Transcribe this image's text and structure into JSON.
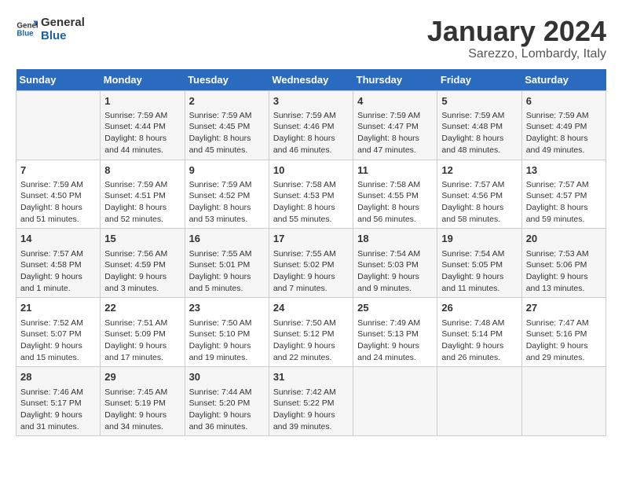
{
  "header": {
    "logo_line1": "General",
    "logo_line2": "Blue",
    "month_title": "January 2024",
    "location": "Sarezzo, Lombardy, Italy"
  },
  "columns": [
    "Sunday",
    "Monday",
    "Tuesday",
    "Wednesday",
    "Thursday",
    "Friday",
    "Saturday"
  ],
  "weeks": [
    [
      {
        "day": "",
        "info": ""
      },
      {
        "day": "1",
        "info": "Sunrise: 7:59 AM\nSunset: 4:44 PM\nDaylight: 8 hours\nand 44 minutes."
      },
      {
        "day": "2",
        "info": "Sunrise: 7:59 AM\nSunset: 4:45 PM\nDaylight: 8 hours\nand 45 minutes."
      },
      {
        "day": "3",
        "info": "Sunrise: 7:59 AM\nSunset: 4:46 PM\nDaylight: 8 hours\nand 46 minutes."
      },
      {
        "day": "4",
        "info": "Sunrise: 7:59 AM\nSunset: 4:47 PM\nDaylight: 8 hours\nand 47 minutes."
      },
      {
        "day": "5",
        "info": "Sunrise: 7:59 AM\nSunset: 4:48 PM\nDaylight: 8 hours\nand 48 minutes."
      },
      {
        "day": "6",
        "info": "Sunrise: 7:59 AM\nSunset: 4:49 PM\nDaylight: 8 hours\nand 49 minutes."
      }
    ],
    [
      {
        "day": "7",
        "info": "Sunrise: 7:59 AM\nSunset: 4:50 PM\nDaylight: 8 hours\nand 51 minutes."
      },
      {
        "day": "8",
        "info": "Sunrise: 7:59 AM\nSunset: 4:51 PM\nDaylight: 8 hours\nand 52 minutes."
      },
      {
        "day": "9",
        "info": "Sunrise: 7:59 AM\nSunset: 4:52 PM\nDaylight: 8 hours\nand 53 minutes."
      },
      {
        "day": "10",
        "info": "Sunrise: 7:58 AM\nSunset: 4:53 PM\nDaylight: 8 hours\nand 55 minutes."
      },
      {
        "day": "11",
        "info": "Sunrise: 7:58 AM\nSunset: 4:55 PM\nDaylight: 8 hours\nand 56 minutes."
      },
      {
        "day": "12",
        "info": "Sunrise: 7:57 AM\nSunset: 4:56 PM\nDaylight: 8 hours\nand 58 minutes."
      },
      {
        "day": "13",
        "info": "Sunrise: 7:57 AM\nSunset: 4:57 PM\nDaylight: 8 hours\nand 59 minutes."
      }
    ],
    [
      {
        "day": "14",
        "info": "Sunrise: 7:57 AM\nSunset: 4:58 PM\nDaylight: 9 hours\nand 1 minute."
      },
      {
        "day": "15",
        "info": "Sunrise: 7:56 AM\nSunset: 4:59 PM\nDaylight: 9 hours\nand 3 minutes."
      },
      {
        "day": "16",
        "info": "Sunrise: 7:55 AM\nSunset: 5:01 PM\nDaylight: 9 hours\nand 5 minutes."
      },
      {
        "day": "17",
        "info": "Sunrise: 7:55 AM\nSunset: 5:02 PM\nDaylight: 9 hours\nand 7 minutes."
      },
      {
        "day": "18",
        "info": "Sunrise: 7:54 AM\nSunset: 5:03 PM\nDaylight: 9 hours\nand 9 minutes."
      },
      {
        "day": "19",
        "info": "Sunrise: 7:54 AM\nSunset: 5:05 PM\nDaylight: 9 hours\nand 11 minutes."
      },
      {
        "day": "20",
        "info": "Sunrise: 7:53 AM\nSunset: 5:06 PM\nDaylight: 9 hours\nand 13 minutes."
      }
    ],
    [
      {
        "day": "21",
        "info": "Sunrise: 7:52 AM\nSunset: 5:07 PM\nDaylight: 9 hours\nand 15 minutes."
      },
      {
        "day": "22",
        "info": "Sunrise: 7:51 AM\nSunset: 5:09 PM\nDaylight: 9 hours\nand 17 minutes."
      },
      {
        "day": "23",
        "info": "Sunrise: 7:50 AM\nSunset: 5:10 PM\nDaylight: 9 hours\nand 19 minutes."
      },
      {
        "day": "24",
        "info": "Sunrise: 7:50 AM\nSunset: 5:12 PM\nDaylight: 9 hours\nand 22 minutes."
      },
      {
        "day": "25",
        "info": "Sunrise: 7:49 AM\nSunset: 5:13 PM\nDaylight: 9 hours\nand 24 minutes."
      },
      {
        "day": "26",
        "info": "Sunrise: 7:48 AM\nSunset: 5:14 PM\nDaylight: 9 hours\nand 26 minutes."
      },
      {
        "day": "27",
        "info": "Sunrise: 7:47 AM\nSunset: 5:16 PM\nDaylight: 9 hours\nand 29 minutes."
      }
    ],
    [
      {
        "day": "28",
        "info": "Sunrise: 7:46 AM\nSunset: 5:17 PM\nDaylight: 9 hours\nand 31 minutes."
      },
      {
        "day": "29",
        "info": "Sunrise: 7:45 AM\nSunset: 5:19 PM\nDaylight: 9 hours\nand 34 minutes."
      },
      {
        "day": "30",
        "info": "Sunrise: 7:44 AM\nSunset: 5:20 PM\nDaylight: 9 hours\nand 36 minutes."
      },
      {
        "day": "31",
        "info": "Sunrise: 7:42 AM\nSunset: 5:22 PM\nDaylight: 9 hours\nand 39 minutes."
      },
      {
        "day": "",
        "info": ""
      },
      {
        "day": "",
        "info": ""
      },
      {
        "day": "",
        "info": ""
      }
    ]
  ]
}
